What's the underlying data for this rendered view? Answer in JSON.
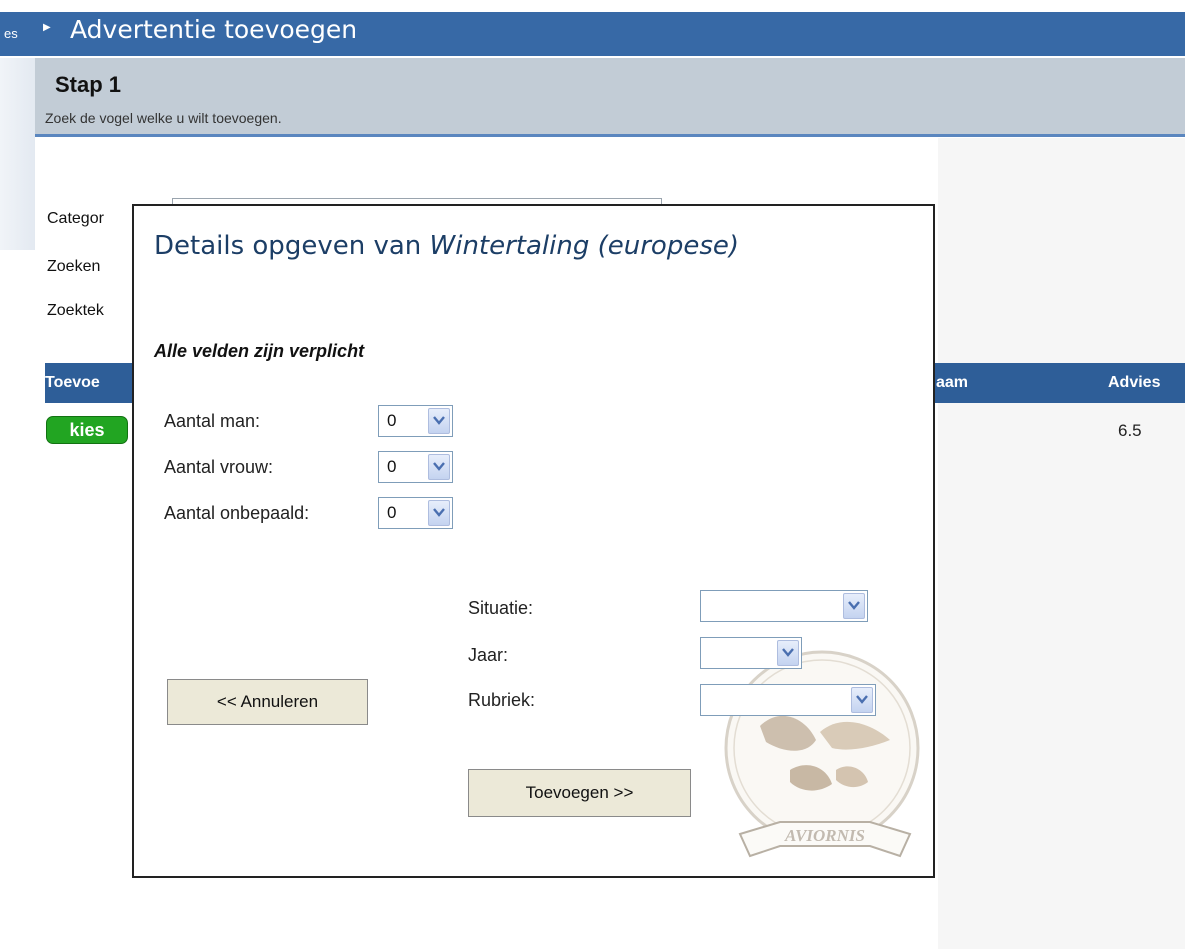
{
  "header": {
    "breadcrumb_fragment": "es",
    "title": "Advertentie toevoegen"
  },
  "step": {
    "title": "Stap 1",
    "subtitle": "Zoek de vogel welke u wilt toevoegen."
  },
  "background_form": {
    "category_label": "Categor",
    "search_label": "Zoeken",
    "search_text_label": "Zoektek"
  },
  "table": {
    "columns": [
      "Toevoe",
      "aam",
      "Advies"
    ],
    "row": {
      "action": "kies",
      "advies": "6.5"
    }
  },
  "dialog": {
    "title_prefix": "Details opgeven van ",
    "bird_name": "Wintertaling (europese)",
    "required_note": "Alle velden zijn verplicht",
    "fields": {
      "male": {
        "label": "Aantal man:",
        "value": "0"
      },
      "female": {
        "label": "Aantal vrouw:",
        "value": "0"
      },
      "undetermined": {
        "label": "Aantal onbepaald:",
        "value": "0"
      },
      "situation": {
        "label": "Situatie:",
        "value": ""
      },
      "year": {
        "label": "Jaar:",
        "value": ""
      },
      "rubric": {
        "label": "Rubriek:",
        "value": ""
      }
    },
    "cancel_label": "<< Annuleren",
    "add_label": "Toevoegen >>",
    "logo_text": "AVIORNIS"
  },
  "colors": {
    "header_bg": "#3769a6",
    "table_header_bg": "#2e5e98",
    "step_bg": "#c2ccd6",
    "kies_green": "#22a522",
    "title_blue": "#1c3e66"
  }
}
